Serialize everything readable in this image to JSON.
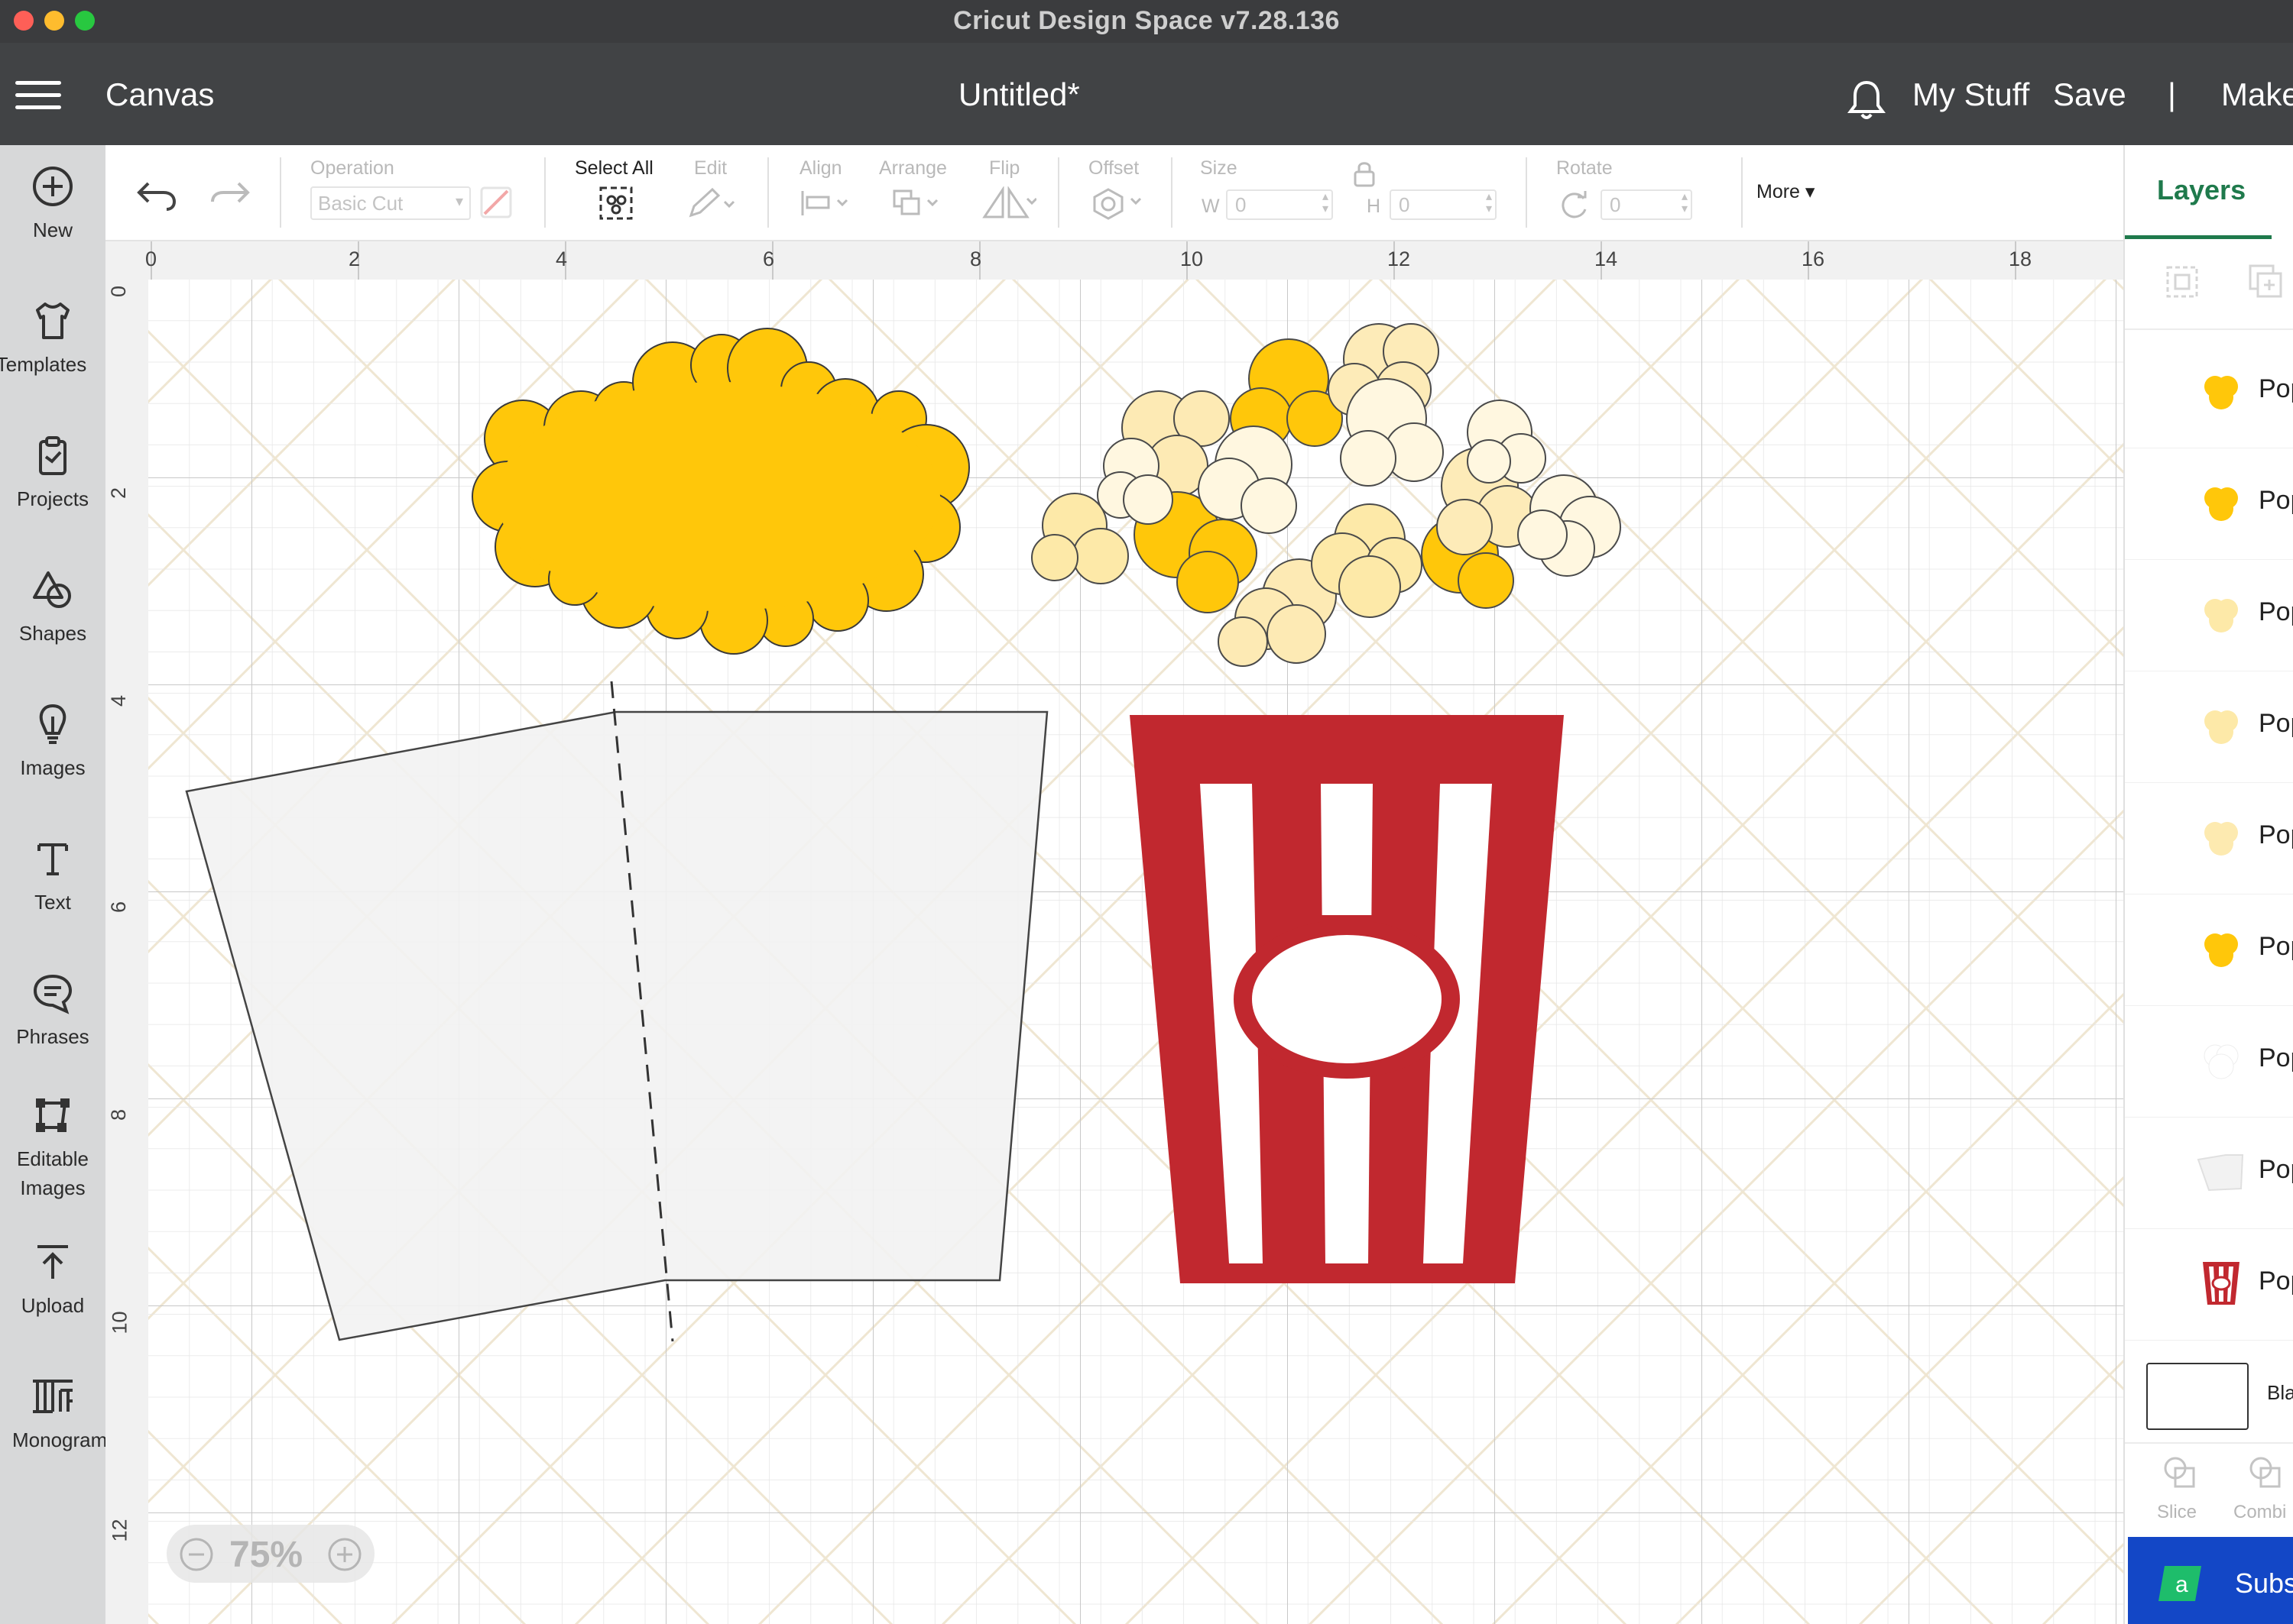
{
  "window": {
    "title": "Cricut Design Space  v7.28.136",
    "traffic_colors": [
      "#fe5f57",
      "#febc2e",
      "#28c840"
    ]
  },
  "header": {
    "section": "Canvas",
    "doc_title": "Untitled*",
    "my_stuff": "My Stuff",
    "save": "Save",
    "divider": "|",
    "make": "Make"
  },
  "sidebar": {
    "items": [
      {
        "label": "New",
        "icon": "plus-circle-icon"
      },
      {
        "label": "Templates",
        "icon": "shirt-icon"
      },
      {
        "label": "Projects",
        "icon": "clipboard-icon"
      },
      {
        "label": "Shapes",
        "icon": "shapes-icon"
      },
      {
        "label": "Images",
        "icon": "bulb-icon"
      },
      {
        "label": "Text",
        "icon": "text-icon"
      },
      {
        "label": "Phrases",
        "icon": "speech-bubble-icon"
      },
      {
        "label": "Editable",
        "label2": "Images",
        "icon": "node-edit-icon"
      },
      {
        "label": "Upload",
        "icon": "upload-icon"
      },
      {
        "label": "Monogram",
        "icon": "monogram-icon"
      }
    ]
  },
  "toolbar": {
    "operation_label": "Operation",
    "operation_value": "Basic Cut",
    "select_all": "Select All",
    "edit": "Edit",
    "align": "Align",
    "arrange": "Arrange",
    "flip": "Flip",
    "offset": "Offset",
    "size": "Size",
    "w_label": "W",
    "w_value": "0",
    "h_label": "H",
    "h_value": "0",
    "rotate": "Rotate",
    "rotate_value": "0",
    "more": "More"
  },
  "rulers": {
    "horizontal": [
      "0",
      "2",
      "4",
      "6",
      "8",
      "10",
      "12",
      "14",
      "16",
      "18"
    ],
    "vertical": [
      "0",
      "2",
      "4",
      "6",
      "8",
      "10",
      "12"
    ]
  },
  "canvas": {
    "zoom": "75%",
    "colors": {
      "popcorn_gold": "#ffc70a",
      "box_red": "#c1282f",
      "light_gray": "#f2f2f2",
      "cream": "#fff7e0",
      "pale_yellow": "#fde9a8"
    }
  },
  "right_panel": {
    "tab": "Layers",
    "layers": [
      {
        "name": "Pop",
        "swatch": "#ffc70a"
      },
      {
        "name": "Pop",
        "swatch": "#ffc70a"
      },
      {
        "name": "Pop",
        "swatch": "#fde9a8"
      },
      {
        "name": "Pop",
        "swatch": "#fde9a8"
      },
      {
        "name": "Pop",
        "swatch": "#fdeab0"
      },
      {
        "name": "Pop",
        "swatch": "#ffc70a"
      },
      {
        "name": "Pop",
        "swatch": "#ffffff"
      },
      {
        "name": "Pop",
        "swatch": "#f2f2f2"
      },
      {
        "name": "Pop",
        "swatch": "#c1282f"
      }
    ],
    "blank_label": "Bla",
    "slice": "Slice",
    "combine": "Combi",
    "subscribe": "Subs"
  }
}
